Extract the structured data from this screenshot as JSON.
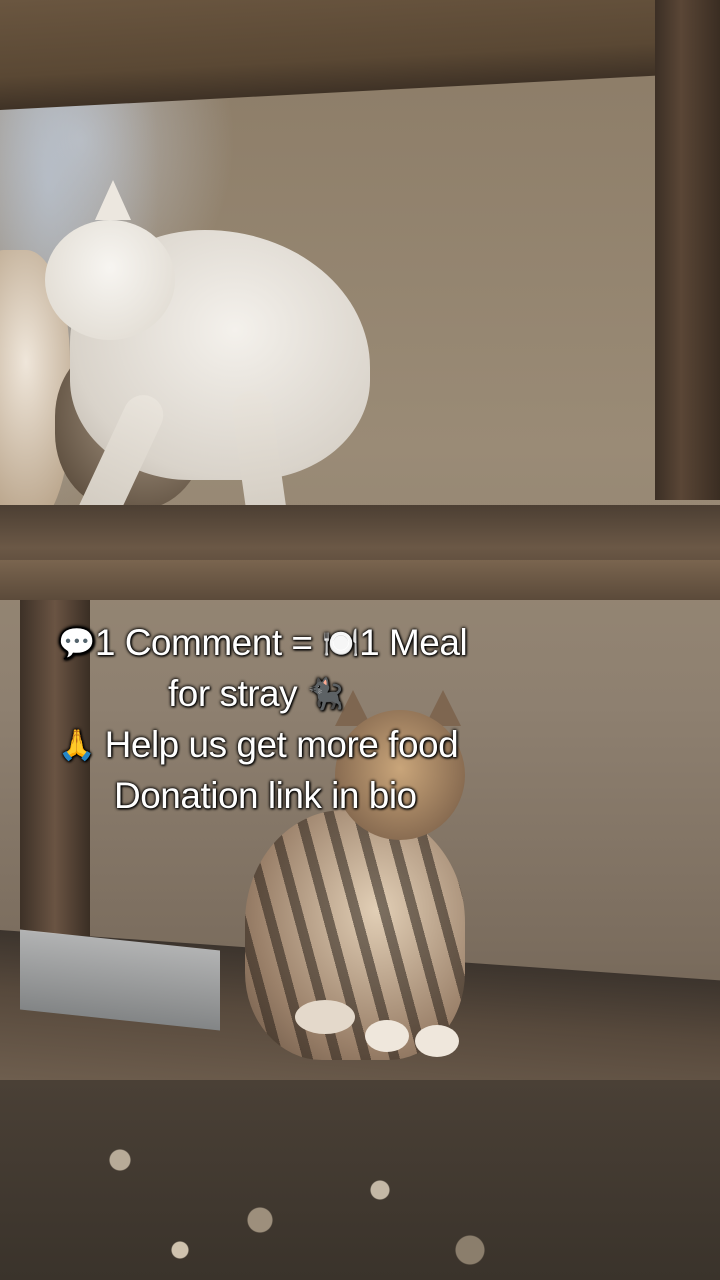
{
  "caption": {
    "line1_emoji": "💬",
    "line1_text_a": "1 Comment = ",
    "line1_emoji2": "🍽️",
    "line1_text_b": "1 Meal",
    "line2_text": "for stray",
    "line2_emoji": "🐈‍⬛",
    "line3_emoji": "🙏",
    "line3_text": "Help us get more food",
    "line4_text": "Donation link in bio"
  },
  "scene": {
    "subject_icons": [
      "white-cat",
      "calico-cat",
      "tabby-cat"
    ]
  }
}
